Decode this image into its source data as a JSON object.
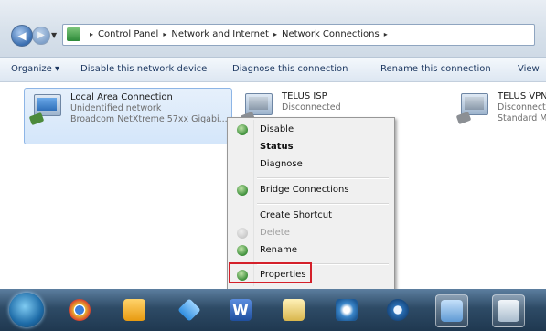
{
  "address_bar": {
    "crumbs": [
      "Control Panel",
      "Network and Internet",
      "Network Connections"
    ],
    "separator": "▸"
  },
  "toolbar": {
    "organize": "Organize ▾",
    "disable": "Disable this network device",
    "diagnose": "Diagnose this connection",
    "rename": "Rename this connection",
    "view": "View"
  },
  "connections": [
    {
      "name": "Local Area Connection",
      "status": "Unidentified network",
      "device": "Broadcom NetXtreme 57xx Gigabi..."
    },
    {
      "name": "TELUS ISP",
      "status": "Disconnected",
      "device": ""
    },
    {
      "name": "TELUS VPN",
      "status": "Disconnect",
      "device": "Standard M"
    }
  ],
  "context_menu": {
    "items": [
      {
        "label": "Disable",
        "icon": "shield-icon",
        "bold": false,
        "disabled": false
      },
      {
        "label": "Status",
        "icon": "",
        "bold": true,
        "disabled": false
      },
      {
        "label": "Diagnose",
        "icon": "",
        "bold": false,
        "disabled": false
      },
      {
        "label": "Bridge Connections",
        "icon": "shield-icon",
        "bold": false,
        "disabled": false
      },
      {
        "label": "Create Shortcut",
        "icon": "",
        "bold": false,
        "disabled": false
      },
      {
        "label": "Delete",
        "icon": "shield-icon",
        "bold": false,
        "disabled": true
      },
      {
        "label": "Rename",
        "icon": "shield-icon",
        "bold": false,
        "disabled": false
      },
      {
        "label": "Properties",
        "icon": "shield-icon",
        "bold": false,
        "disabled": false
      }
    ]
  },
  "taskbar": {
    "apps": [
      {
        "icon": "chrome-icon",
        "color": "#e8b431"
      },
      {
        "icon": "outlook-icon",
        "color": "#f0a020"
      },
      {
        "icon": "dropbox-icon",
        "color": "#4aa4e8"
      },
      {
        "icon": "word-icon",
        "color": "#2b5fb8"
      },
      {
        "icon": "folder-icon",
        "color": "#e8d07a"
      },
      {
        "icon": "network-icon",
        "color": "#3b86c9"
      },
      {
        "icon": "media-player-icon",
        "color": "#2a6fb5"
      },
      {
        "icon": "control-panel-icon",
        "color": "#7bb0de"
      },
      {
        "icon": "paint-icon",
        "color": "#c9d6e2"
      }
    ]
  },
  "colors": {
    "highlight_box": "#d4202a",
    "selection": "#d4e6fa"
  }
}
